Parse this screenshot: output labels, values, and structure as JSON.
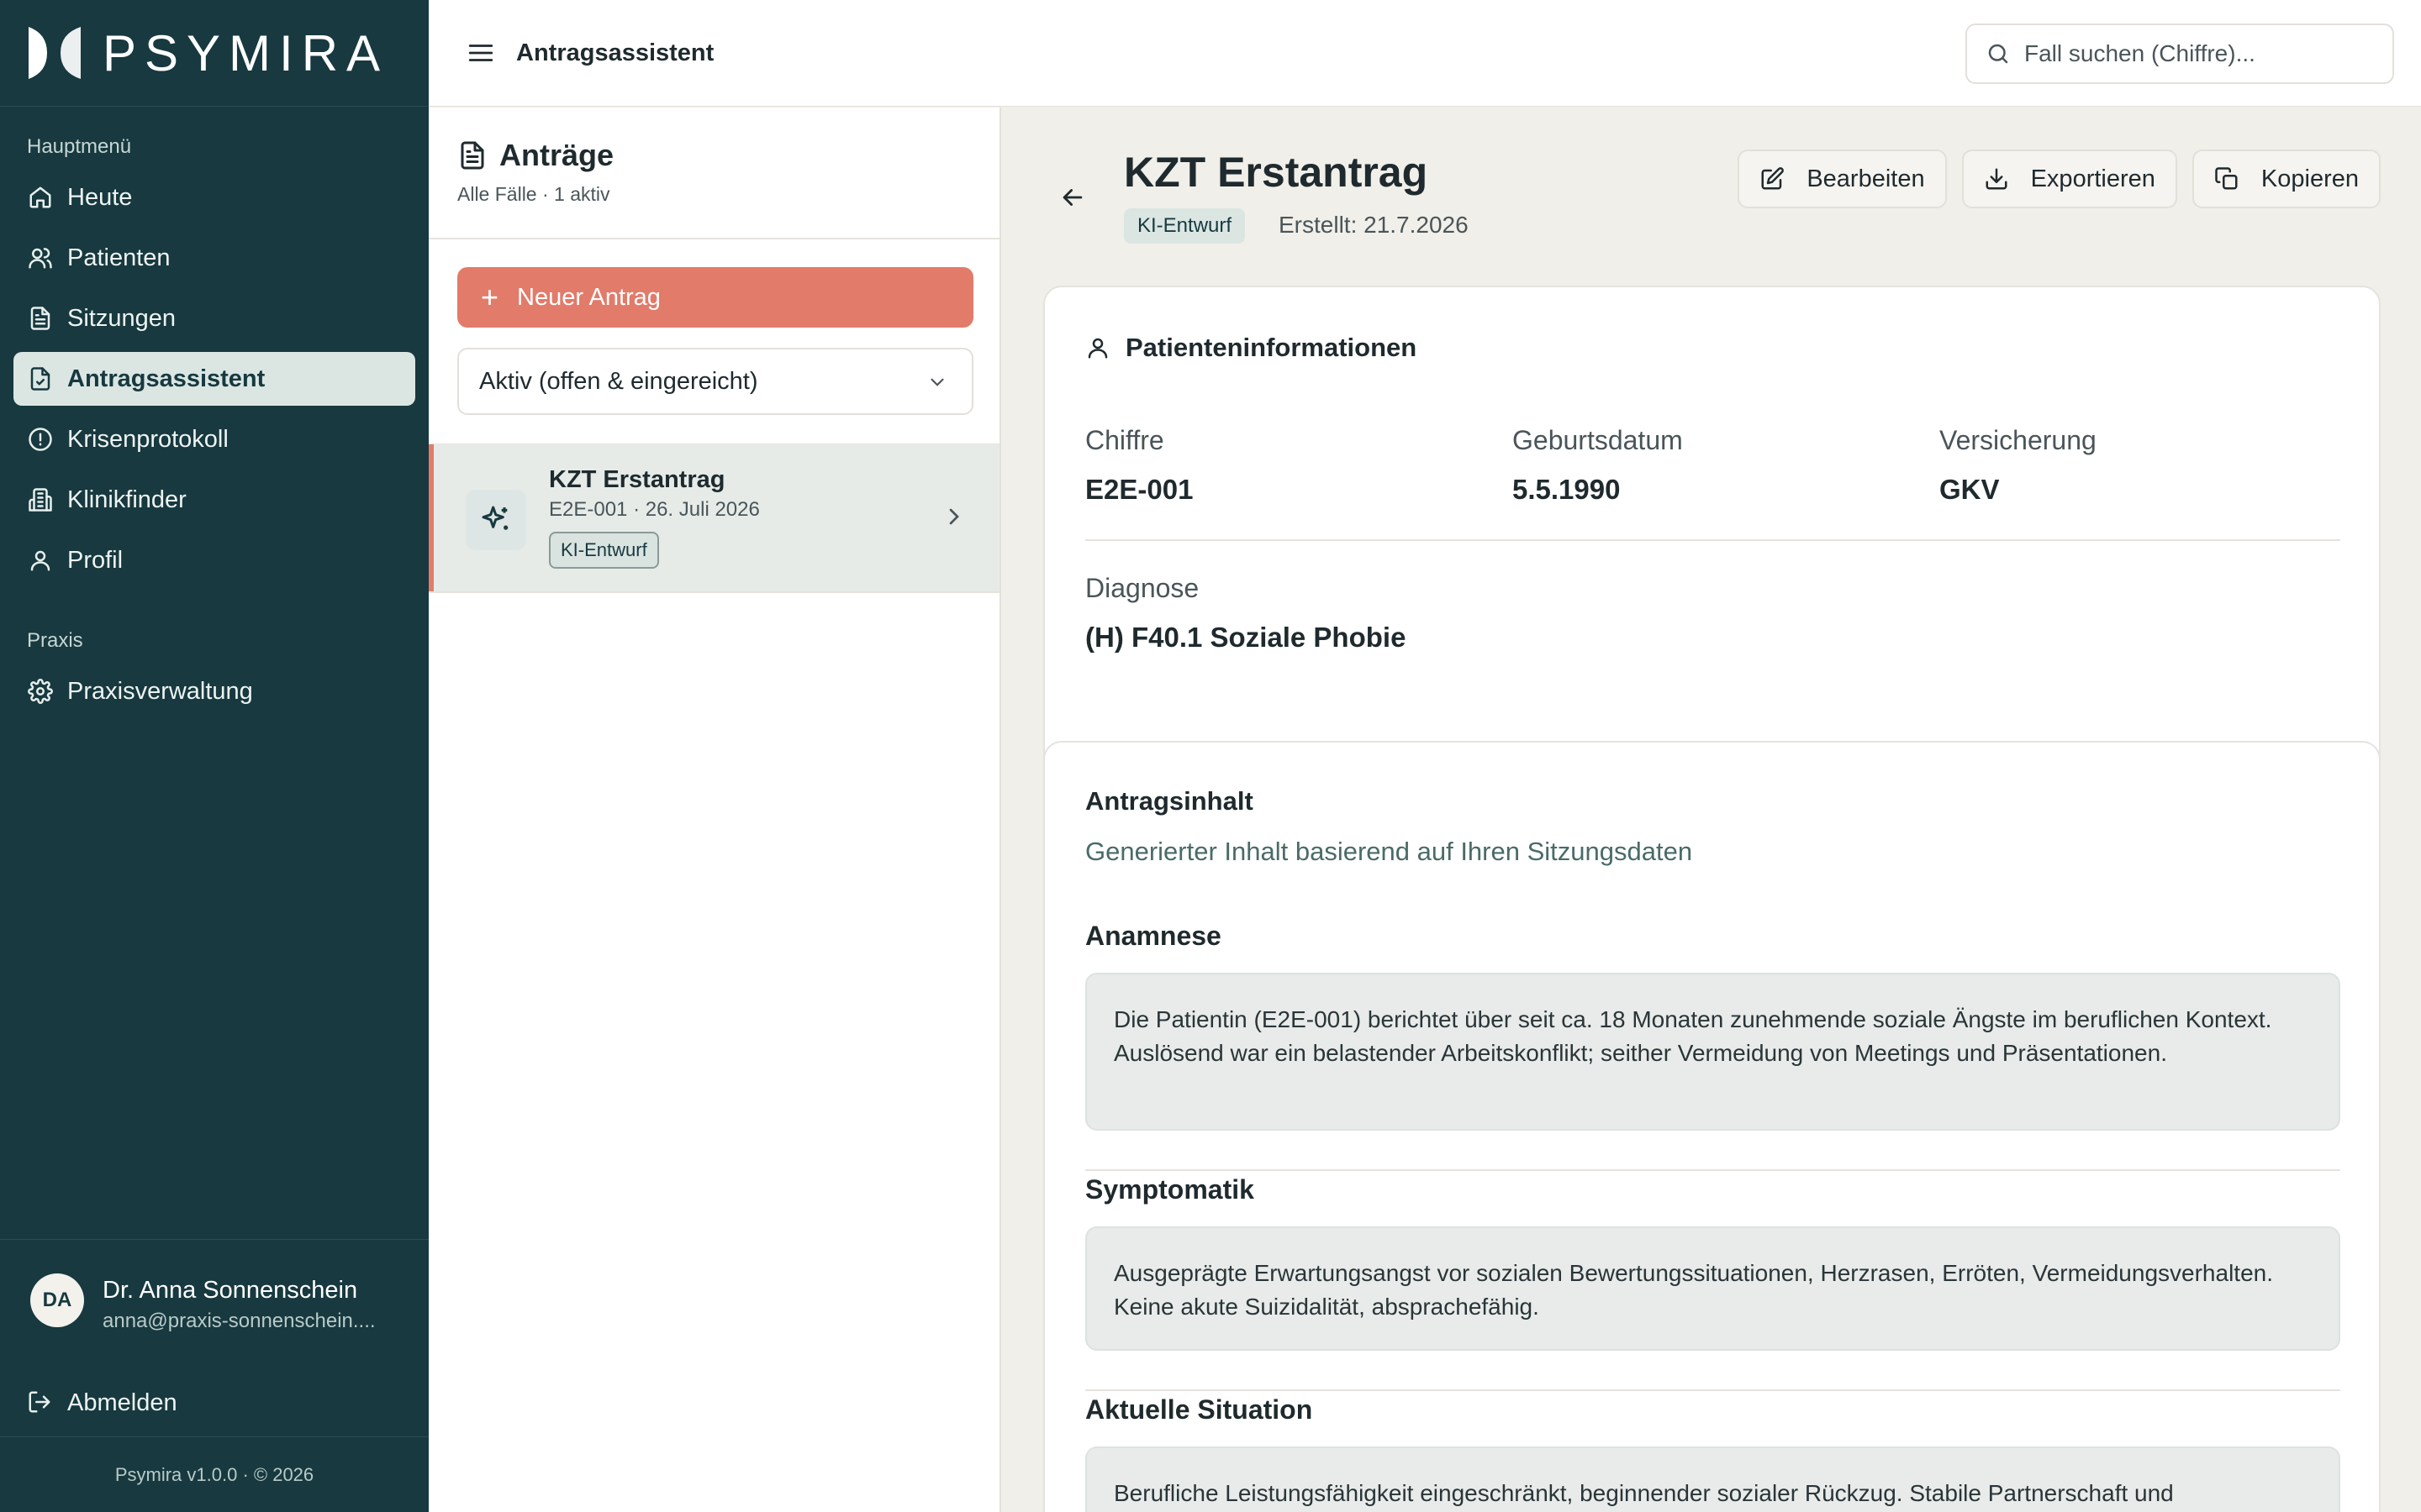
{
  "app": {
    "brand": "PSYMIRA"
  },
  "sidebar": {
    "section_main": "Hauptmenü",
    "items": [
      {
        "label": "Heute",
        "icon": "home-icon"
      },
      {
        "label": "Patienten",
        "icon": "users-icon"
      },
      {
        "label": "Sitzungen",
        "icon": "document-icon"
      },
      {
        "label": "Antragsassistent",
        "icon": "document-check-icon",
        "active": true
      },
      {
        "label": "Krisenprotokoll",
        "icon": "alert-circle-icon"
      },
      {
        "label": "Klinikfinder",
        "icon": "building-icon"
      },
      {
        "label": "Profil",
        "icon": "user-icon"
      }
    ],
    "section_practice": "Praxis",
    "practice_items": [
      {
        "label": "Praxisverwaltung",
        "icon": "gear-icon"
      }
    ],
    "user": {
      "initials": "DA",
      "name": "Dr. Anna Sonnenschein",
      "email": "anna@praxis-sonnenschein...."
    },
    "logout_label": "Abmelden",
    "version": "Psymira v1.0.0 · © 2026"
  },
  "topbar": {
    "title": "Antragsassistent",
    "search_placeholder": "Fall suchen (Chiffre)..."
  },
  "list": {
    "title": "Anträge",
    "subtitle": "Alle Fälle · 1 aktiv",
    "new_button": "Neuer Antrag",
    "filter_value": "Aktiv (offen & eingereicht)",
    "items": [
      {
        "title": "KZT Erstantrag",
        "subtitle": "E2E-001 · 26. Juli 2026",
        "badge": "KI-Entwurf"
      }
    ]
  },
  "detail": {
    "title": "KZT Erstantrag",
    "badge": "KI-Entwurf",
    "created": "Erstellt: 21.7.2026",
    "actions": {
      "edit": "Bearbeiten",
      "export": "Exportieren",
      "copy": "Kopieren"
    },
    "patient_card": {
      "title": "Patienteninformationen",
      "fields": {
        "chiffre_label": "Chiffre",
        "chiffre_value": "E2E-001",
        "birth_label": "Geburtsdatum",
        "birth_value": "5.5.1990",
        "insurance_label": "Versicherung",
        "insurance_value": "GKV",
        "diagnosis_label": "Diagnose",
        "diagnosis_value": "(H) F40.1 Soziale Phobie"
      }
    },
    "content_card": {
      "title": "Antragsinhalt",
      "subtitle": "Generierter Inhalt basierend auf Ihren Sitzungsdaten",
      "sections": [
        {
          "title": "Anamnese",
          "text": "Die Patientin (E2E-001) berichtet über seit ca. 18 Monaten zunehmende soziale Ängste im beruflichen Kontext. Auslösend war ein belastender Arbeitskonflikt; seither Vermeidung von Meetings und Präsentationen."
        },
        {
          "title": "Symptomatik",
          "text": "Ausgeprägte Erwartungsangst vor sozialen Bewertungssituationen, Herzrasen, Erröten, Vermeidungsverhalten. Keine akute Suizidalität, absprachefähig."
        },
        {
          "title": "Aktuelle Situation",
          "text": "Berufliche Leistungsfähigkeit eingeschränkt, beginnender sozialer Rückzug. Stabile Partnerschaft und"
        }
      ]
    }
  },
  "colors": {
    "sidebar_bg": "#17393f",
    "accent": "#e27b6a",
    "page_bg": "#f1efe9"
  }
}
